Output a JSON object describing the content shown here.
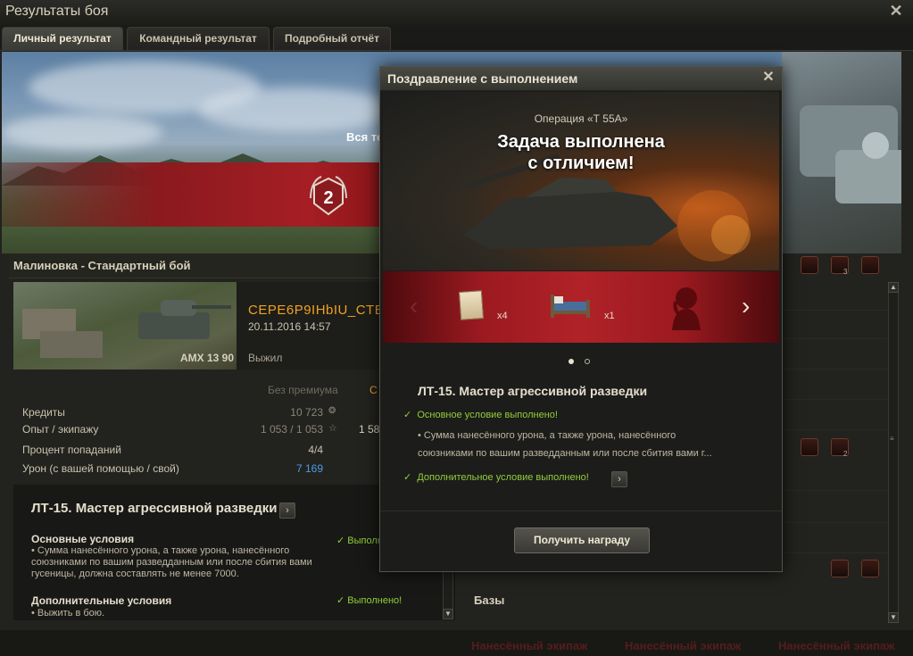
{
  "window": {
    "title": "Результаты боя",
    "close_icon": "close-icon"
  },
  "tabs": [
    {
      "label": "Личный результат",
      "active": true
    },
    {
      "label": "Командный результат",
      "active": false
    },
    {
      "label": "Подробный отчёт",
      "active": false
    }
  ],
  "banner": {
    "partial_text": "Вся те",
    "rank": "2"
  },
  "battle": {
    "map_mode": "Малиновка - Стандартный бой"
  },
  "player": {
    "name": "CEPE6P9IHbIU_CTBO",
    "datetime": "20.11.2016 14:57",
    "tank": "AMX 13 90",
    "status": "Выжил"
  },
  "stats": {
    "col_no_premium": "Без премиума",
    "col_premium_partial": "С",
    "rows": [
      {
        "label": "Кредиты",
        "value": "10 723",
        "premium": ""
      },
      {
        "label": "Опыт / экипажу",
        "value": "1 053 / 1 053",
        "premium": "1 58"
      },
      {
        "label": "Процент попаданий",
        "value": "4/4",
        "premium": ""
      },
      {
        "label": "Урон (с вашей помощью / свой)",
        "value": "7 169",
        "premium": ""
      }
    ]
  },
  "task_panel": {
    "title": "ЛТ-15. Мастер агрессивной разведки",
    "main_conditions_title": "Основные условия",
    "main_conditions_text": "• Сумма нанесённого урона, а также урона, нанесённого союзниками по вашим разведданным или после сбития вами гусеницы, должна составлять не менее 7000.",
    "main_done_partial": "Выполн",
    "extra_conditions_title": "Дополнительные условия",
    "extra_conditions_text": "• Выжить в бою.",
    "extra_done": "Выполнено!"
  },
  "right_panel": {
    "bases_label": "Базы",
    "achievement_counts": [
      "3",
      "2"
    ]
  },
  "bottom_ghost_text": [
    "Нанесённый экипаж",
    "Нанесённый экипаж",
    "Нанесённый экипаж"
  ],
  "dialog": {
    "title": "Поздравление с выполнением",
    "operation": "Операция «Т 55А»",
    "headline_line1": "Задача выполнена",
    "headline_line2": "с отличием!",
    "rewards": [
      {
        "icon": "document-icon",
        "qty": "x4"
      },
      {
        "icon": "barracks-bed-icon",
        "qty": "x1"
      },
      {
        "icon": "female-crew-icon",
        "qty": ""
      }
    ],
    "task_title": "ЛТ-15. Мастер агрессивной разведки",
    "main_done": "Основное условие выполнено!",
    "main_text_line1": "• Сумма нанесённого урона, а также урона, нанесённого",
    "main_text_line2": "союзниками по вашим разведданным или после сбития вами г...",
    "extra_done": "Дополнительное условие выполнено!",
    "button": "Получить награду"
  },
  "colors": {
    "accent_red": "#a51e24",
    "player_name": "#f0a21f",
    "success_green": "#8fcf3a",
    "damage_blue": "#4f9be6"
  }
}
